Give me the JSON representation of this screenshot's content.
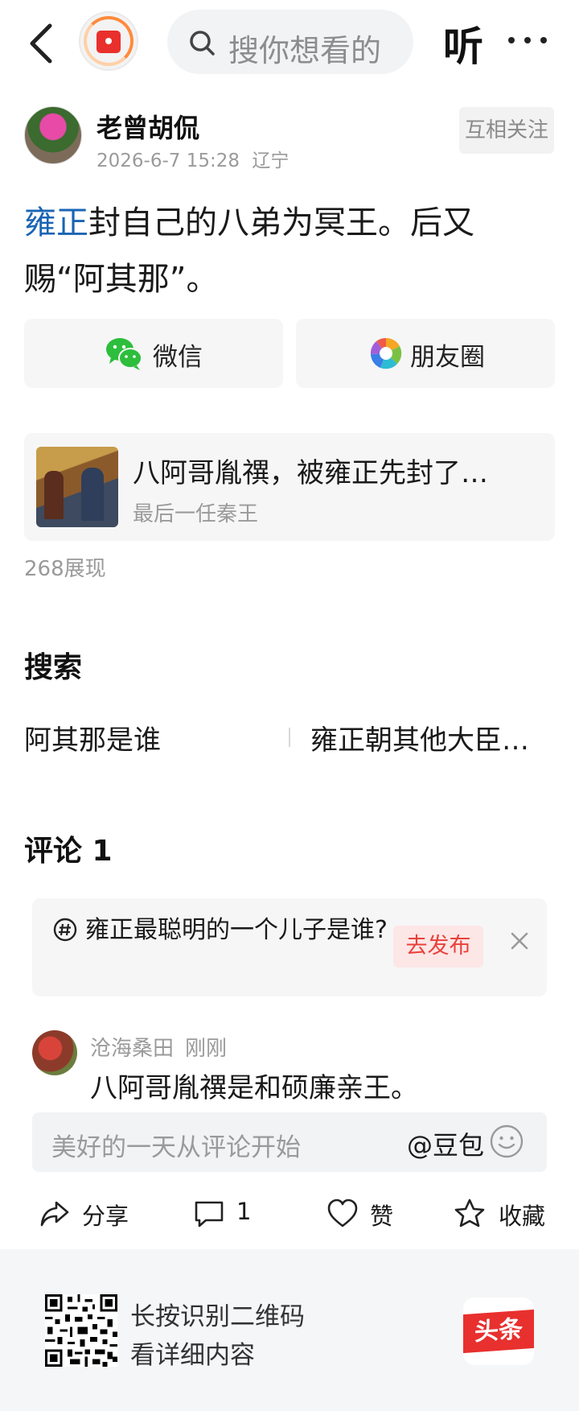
{
  "header": {
    "search_placeholder": "搜你想看的",
    "listen_label": "听"
  },
  "author": {
    "name": "老曾胡侃",
    "datetime": "2026-6-7 15:28",
    "location": "辽宁",
    "follow_label": "互相关注"
  },
  "post": {
    "link_text": "雍正",
    "text_rest": "封自己的八弟为冥王。后又赐“阿其那”。"
  },
  "share": {
    "wechat_label": "微信",
    "moments_label": "朋友圈"
  },
  "related": {
    "title": "八阿哥胤禩，被雍正先封了…",
    "author": "最后一任秦王",
    "views": "268展现"
  },
  "search_section": {
    "title": "搜索",
    "suggestions": [
      "阿其那是谁",
      "雍正朝其他大臣…"
    ]
  },
  "comments_section": {
    "title": "评论 1",
    "topic_text": "雍正最聪明的一个儿子是谁?",
    "publish_label": "去发布",
    "comments": [
      {
        "user": "沧海桑田",
        "time": "刚刚",
        "text": "八阿哥胤禩是和硕廉亲王。"
      }
    ],
    "input_placeholder": "美好的一天从评论开始",
    "at_label": "@豆包"
  },
  "actions": {
    "share_label": "分享",
    "comment_count": "1",
    "like_label": "赞",
    "favorite_label": "收藏"
  },
  "footer": {
    "line1": "长按识别二维码",
    "line2": "看详细内容",
    "brand": "头条"
  },
  "colors": {
    "link": "#1a64b4",
    "accent_red": "#e8413a",
    "muted": "#9a9a9a"
  }
}
